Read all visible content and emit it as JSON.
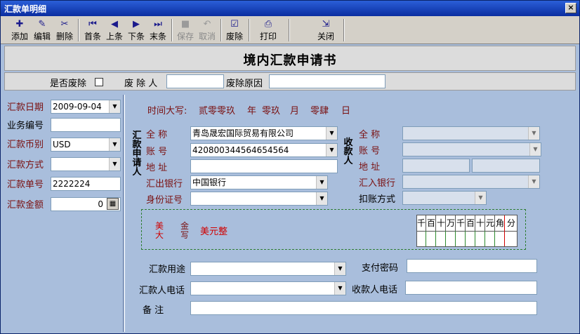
{
  "window": {
    "title": "汇款单明细",
    "close": "×"
  },
  "toolbar": [
    {
      "label": "添加",
      "icon": "add-icon",
      "glyph": "✚",
      "enabled": true
    },
    {
      "label": "编辑",
      "icon": "edit-icon",
      "glyph": "✎",
      "enabled": true
    },
    {
      "label": "删除",
      "icon": "delete-icon",
      "glyph": "✂",
      "enabled": true
    },
    {
      "label": "首条",
      "icon": "first-record-icon",
      "glyph": "⏮",
      "enabled": true
    },
    {
      "label": "上条",
      "icon": "previous-record-icon",
      "glyph": "◀",
      "enabled": true
    },
    {
      "label": "下条",
      "icon": "next-record-icon",
      "glyph": "▶",
      "enabled": true
    },
    {
      "label": "末条",
      "icon": "last-record-icon",
      "glyph": "⏭",
      "enabled": true
    },
    {
      "label": "保存",
      "icon": "save-icon",
      "glyph": "■",
      "enabled": false
    },
    {
      "label": "取消",
      "icon": "undo-icon",
      "glyph": "↶",
      "enabled": false
    },
    {
      "label": "废除",
      "icon": "void-icon",
      "glyph": "☑",
      "enabled": true
    },
    {
      "label": "打印",
      "icon": "print-icon",
      "glyph": "⎙",
      "enabled": true
    },
    {
      "label": "关闭",
      "icon": "exit-icon",
      "glyph": "⇲",
      "enabled": true
    }
  ],
  "form_title": "境内汇款申请书",
  "void_row": {
    "is_void_label": "是否废除",
    "voider_label": "废 除 人",
    "voider_value": "",
    "reason_label": "废除原因",
    "reason_value": ""
  },
  "left": {
    "date_label": "汇款日期",
    "date_value": "2009-09-04",
    "bizno_label": "业务编号",
    "bizno_value": "",
    "currency_label": "汇款币别",
    "currency_value": "USD",
    "method_label": "汇款方式",
    "method_value": "",
    "slip_label": "汇款单号",
    "slip_value": "2222224",
    "amount_label": "汇款金额",
    "amount_value": "0"
  },
  "date_caps": {
    "label": "时间大写:",
    "year": "贰零零玖",
    "year_unit": "年",
    "month": "零玖",
    "month_unit": "月",
    "day": "零肆",
    "day_unit": "日"
  },
  "remitter": {
    "side_label": "汇款申请人",
    "name_label": "全    称",
    "name_value": "青岛晟宏国际贸易有限公司",
    "account_label": "账    号",
    "account_value": "420800344564654564",
    "address_label": "地    址",
    "address_value": "",
    "bank_label": "汇出银行",
    "bank_value": "中国银行",
    "id_label": "身份证号",
    "id_value": ""
  },
  "payee": {
    "side_label": "收款人",
    "name_label": "全    称",
    "name_value": "",
    "account_label": "账    号",
    "account_value": "",
    "address_label": "地    址",
    "address_value": "",
    "address_value2": "",
    "bank_label": "汇入银行",
    "bank_value": "",
    "debit_label": "扣账方式",
    "debit_value": ""
  },
  "amount_caps": {
    "currency_word_1": "美",
    "currency_word_2": "大",
    "caps_1": "金",
    "caps_2": "写",
    "text": "美元整"
  },
  "digits": [
    "千",
    "百",
    "十",
    "万",
    "千",
    "百",
    "十",
    "元",
    "角",
    "分"
  ],
  "bottom": {
    "purpose_label": "汇款用途",
    "purpose_value": "",
    "pay_pwd_label": "支付密码",
    "pay_pwd_value": "",
    "remitter_phone_label": "汇款人电话",
    "remitter_phone_value": "",
    "payee_phone_label": "收款人电话",
    "payee_phone_value": "",
    "remark_label": "备    注",
    "remark_value": ""
  },
  "colors": {
    "window_bg": "#a9bedc",
    "title_bar": "#0a2da0",
    "label_red": "#7a1010",
    "amount_red": "#d00000"
  }
}
